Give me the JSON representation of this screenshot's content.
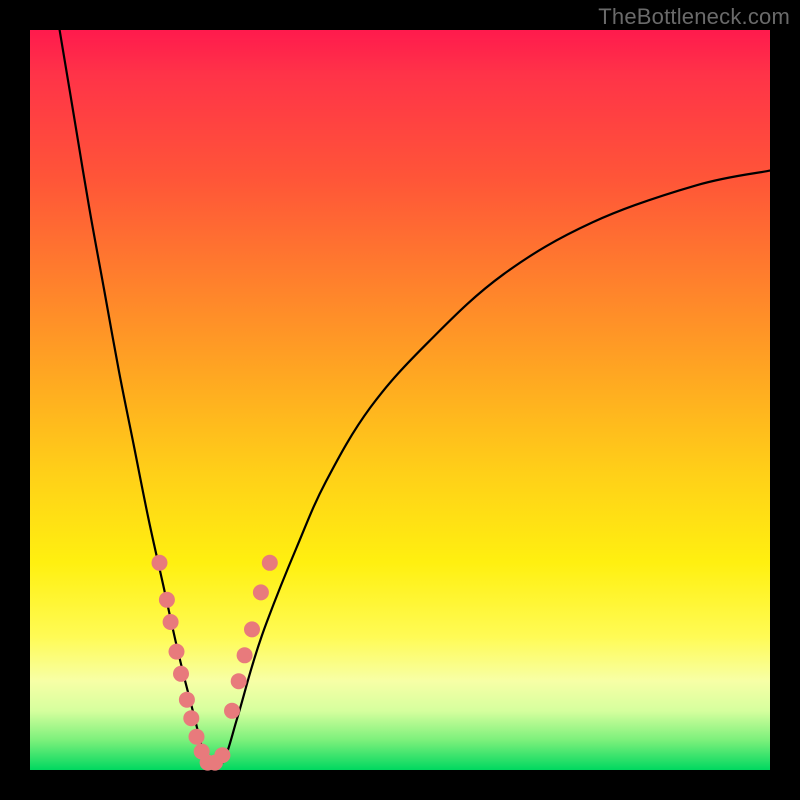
{
  "watermark": "TheBottleneck.com",
  "colors": {
    "frame": "#000000",
    "curve": "#000000",
    "dot": "#e87a7c"
  },
  "chart_data": {
    "type": "line",
    "title": "",
    "xlabel": "",
    "ylabel": "",
    "xlim": [
      0,
      100
    ],
    "ylim": [
      0,
      100
    ],
    "grid": false,
    "note": "V-shaped bottleneck curve; y = bottleneck %, minimum near x≈24. No numeric axis ticks visible.",
    "series": [
      {
        "name": "bottleneck-curve",
        "x": [
          4,
          6,
          8,
          10,
          12,
          14,
          16,
          18,
          20,
          22,
          24,
          26,
          28,
          30,
          32,
          36,
          40,
          46,
          54,
          64,
          76,
          90,
          100
        ],
        "y": [
          100,
          88,
          76,
          65,
          54,
          44,
          34,
          25,
          16,
          8,
          1,
          1,
          7,
          14,
          20,
          30,
          39,
          49,
          58,
          67,
          74,
          79,
          81
        ]
      }
    ],
    "highlight_points": {
      "name": "sample-dots",
      "note": "salmon dots clustered on both arms near the valley",
      "x": [
        17.5,
        18.5,
        19.0,
        19.8,
        20.4,
        21.2,
        21.8,
        22.5,
        23.2,
        24.0,
        25.0,
        26.0,
        27.3,
        28.2,
        29.0,
        30.0,
        31.2,
        32.4
      ],
      "y": [
        28.0,
        23.0,
        20.0,
        16.0,
        13.0,
        9.5,
        7.0,
        4.5,
        2.5,
        1.0,
        1.0,
        2.0,
        8.0,
        12.0,
        15.5,
        19.0,
        24.0,
        28.0
      ]
    }
  }
}
